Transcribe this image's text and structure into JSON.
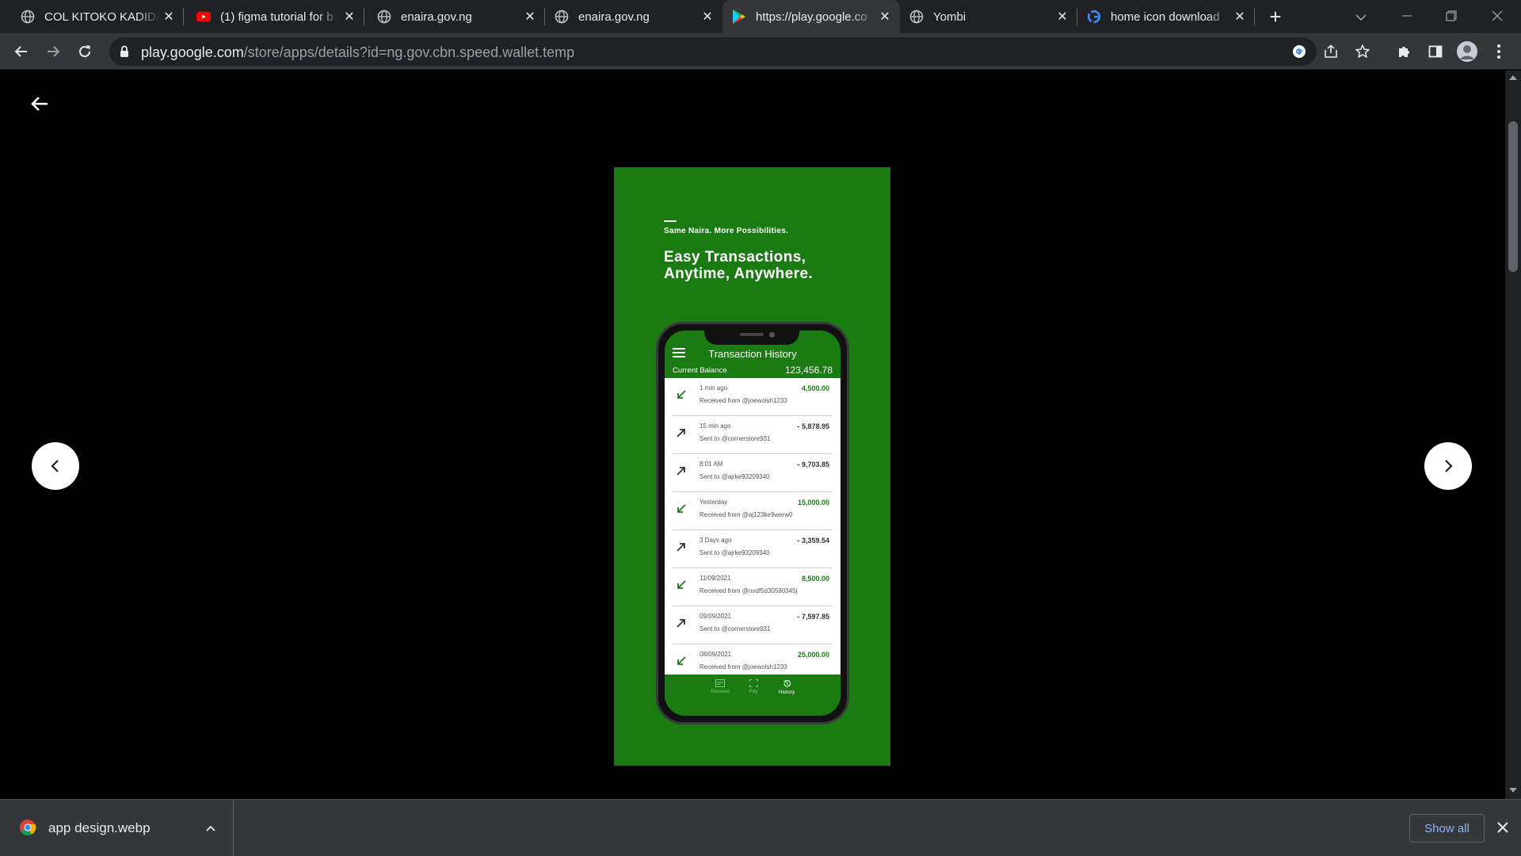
{
  "browser": {
    "tabs": [
      {
        "title": "COL KITOKO KADIDA",
        "favicon": "globe-icon",
        "active": false
      },
      {
        "title": "(1) figma tutorial for b",
        "favicon": "youtube-icon",
        "active": false
      },
      {
        "title": "enaira.gov.ng",
        "favicon": "globe-icon",
        "active": false
      },
      {
        "title": "enaira.gov.ng",
        "favicon": "globe-icon",
        "active": false
      },
      {
        "title": "https://play.google.co",
        "favicon": "google-play-icon",
        "active": true
      },
      {
        "title": "Yombi",
        "favicon": "globe-icon",
        "active": false
      },
      {
        "title": "home icon download",
        "favicon": "google-icon",
        "active": false
      }
    ],
    "new_tab_label": "+",
    "url_host": "play.google.com",
    "url_path": "/store/apps/details?id=ng.gov.cbn.speed.wallet.temp"
  },
  "screenshot": {
    "tagline": "Same Naira. More Possibilities.",
    "headline": "Easy Transactions, Anytime, Anywhere.",
    "screen_title": "Transaction History",
    "balance_label": "Current Balance",
    "balance_value": "123,456.78",
    "transactions": [
      {
        "when": "1 min ago",
        "who": "Received from @joewolsh1233",
        "amount": "4,500.00",
        "direction": "in"
      },
      {
        "when": "15 min ago",
        "who": "Sent to @cornerstore931",
        "amount": "- 5,878.95",
        "direction": "out"
      },
      {
        "when": "8:01 AM",
        "who": "Sent to @ajrke93209340",
        "amount": "- 9,703.85",
        "direction": "out"
      },
      {
        "when": "Yesterday",
        "who": "Received from @aj123ke9werw0",
        "amount": "15,000.00",
        "direction": "in"
      },
      {
        "when": "3 Days ago",
        "who": "Sent to @ajrke93209340",
        "amount": "- 3,359.54",
        "direction": "out"
      },
      {
        "when": "11/09/2021",
        "who": "Received from @nvdf5d30590345j",
        "amount": "8,500.00",
        "direction": "in"
      },
      {
        "when": "09/09/2021",
        "who": "Sent to @cornerstore931",
        "amount": "- 7,597.85",
        "direction": "out"
      },
      {
        "when": "08/09/2021",
        "who": "Received from @joewolsh1233",
        "amount": "25,000.00",
        "direction": "in"
      }
    ],
    "bottom_nav": [
      {
        "label": "Receive",
        "icon": "receive-icon",
        "active": false
      },
      {
        "label": "Pay",
        "icon": "scan-icon",
        "active": false
      },
      {
        "label": "History",
        "icon": "history-icon",
        "active": true
      }
    ]
  },
  "download_shelf": {
    "file_name": "app design.webp",
    "show_all_label": "Show all"
  },
  "colors": {
    "brand_green": "#1b7b13",
    "chrome_dark": "#202124",
    "chrome_toolbar": "#35363a",
    "link_blue": "#8ab4f8"
  }
}
